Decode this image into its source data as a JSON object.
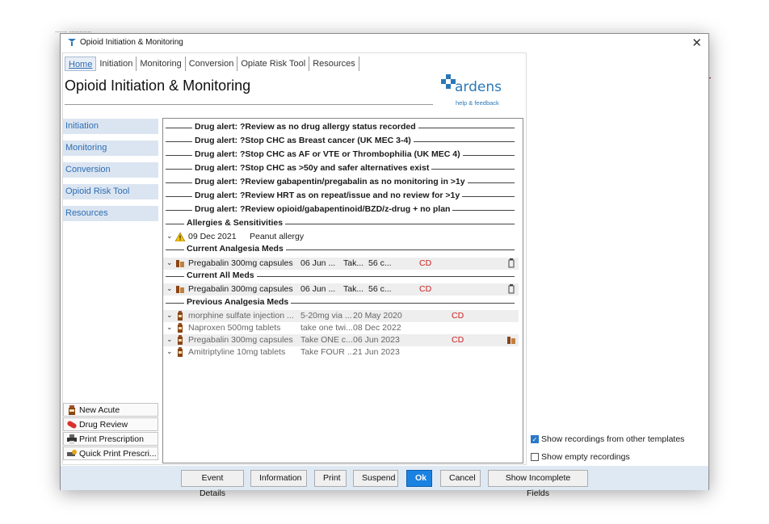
{
  "window": {
    "title": "Opioid Initiation & Monitoring",
    "background_remnant": "...... ..........."
  },
  "tabs": [
    "Home",
    "Initiation",
    "Monitoring",
    "Conversion",
    "Opiate Risk Tool",
    "Resources"
  ],
  "page_title": "Opioid Initiation & Monitoring",
  "logo": {
    "word": "ardens",
    "sub": "help & feedback",
    "color": "#2b78b8"
  },
  "nav": [
    "Initiation",
    "Monitoring",
    "Conversion",
    "Opioid Risk Tool",
    "Resources"
  ],
  "actions": [
    {
      "label": "New Acute",
      "icon": "bottle-icon"
    },
    {
      "label": "Drug Review",
      "icon": "pill-icon"
    },
    {
      "label": "Print Prescription",
      "icon": "printer-icon"
    },
    {
      "label": "Quick Print Prescri...",
      "icon": "quick-print-icon"
    }
  ],
  "alerts": [
    "Drug alert: ?Review as no drug allergy status recorded",
    "Drug alert: ?Stop CHC as Breast cancer (UK MEC 3-4)",
    "Drug alert: ?Stop CHC as AF or VTE or Thrombophilia (UK MEC 4)",
    "Drug alert: ?Stop CHC as >50y and safer alternatives exist",
    "Drug alert: ?Review gabapentin/pregabalin as no monitoring in >1y",
    "Drug alert: ?Review HRT as on repeat/issue and no review for >1y",
    "Drug alert: ?Review opioid/gabapentinoid/BZD/z-drug + no plan"
  ],
  "sections": {
    "allergies": {
      "title": "Allergies & Sensitivities",
      "items": [
        {
          "date": "09 Dec 2021",
          "text": "Peanut allergy"
        }
      ]
    },
    "current_analgesia": {
      "title": "Current Analgesia Meds",
      "items": [
        {
          "name": "Pregabalin 300mg capsules",
          "start": "06 Jun ...",
          "dose": "Tak...",
          "qty": "56 c...",
          "flag": "CD"
        }
      ]
    },
    "current_all": {
      "title": "Current All Meds",
      "items": [
        {
          "name": "Pregabalin 300mg capsules",
          "start": "06 Jun ...",
          "dose": "Tak...",
          "qty": "56 c...",
          "flag": "CD"
        }
      ]
    },
    "previous_analgesia": {
      "title": "Previous Analgesia Meds",
      "items": [
        {
          "name": "morphine sulfate injection ...",
          "dose": "5-20mg via ...",
          "date": "20 May 2020",
          "flag": "CD"
        },
        {
          "name": "Naproxen 500mg tablets",
          "dose": "take one twi...",
          "date": "08 Dec 2022",
          "flag": ""
        },
        {
          "name": "Pregabalin 300mg capsules",
          "dose": "Take ONE c...",
          "date": "06 Jun 2023",
          "flag": "CD"
        },
        {
          "name": "Amitriptyline 10mg tablets",
          "dose": "Take FOUR ...",
          "date": "21 Jun 2023",
          "flag": ""
        }
      ]
    }
  },
  "options": [
    {
      "label": "Show recordings from other templates",
      "checked": true
    },
    {
      "label": "Show empty recordings",
      "checked": false
    }
  ],
  "footer_buttons": [
    "Event Details",
    "Information",
    "Print",
    "Suspend",
    "Ok",
    "Cancel",
    "Show Incomplete Fields"
  ],
  "colors": {
    "accent": "#2d6db3",
    "cd_red": "#cc2222",
    "ok_blue": "#1a82e0",
    "footer_bg": "#dfe9f4",
    "nav_bg": "#dbe5f1"
  }
}
